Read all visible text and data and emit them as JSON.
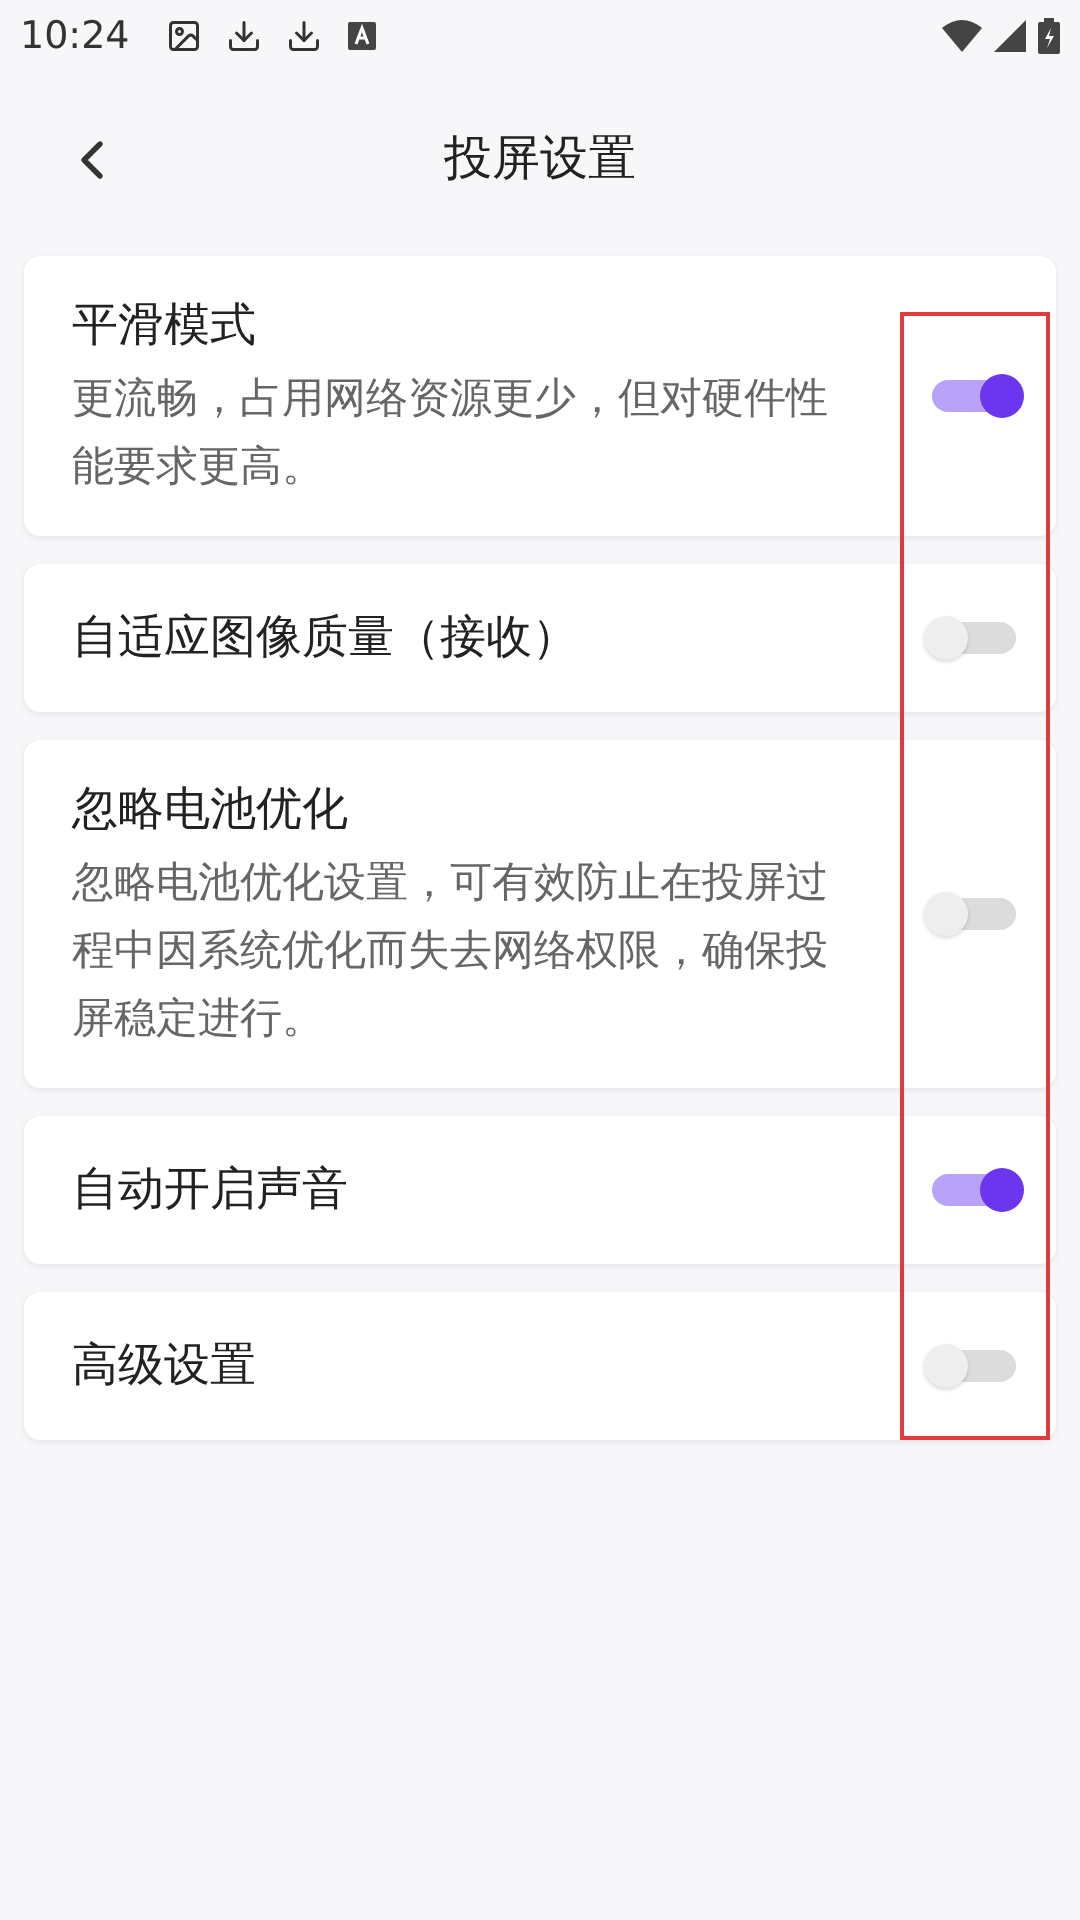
{
  "status_bar": {
    "time": "10:24"
  },
  "header": {
    "title": "投屏设置"
  },
  "settings": [
    {
      "title": "平滑模式",
      "description": "更流畅，占用网络资源更少，但对硬件性能要求更高。",
      "on": true
    },
    {
      "title": "自适应图像质量（接收）",
      "on": false
    },
    {
      "title": "忽略电池优化",
      "description": "忽略电池优化设置，可有效防止在投屏过程中因系统优化而失去网络权限，确保投屏稳定进行。",
      "on": false
    },
    {
      "title": "自动开启声音",
      "on": true
    },
    {
      "title": "高级设置",
      "on": false
    }
  ],
  "annotation": {
    "kind": "frame"
  }
}
